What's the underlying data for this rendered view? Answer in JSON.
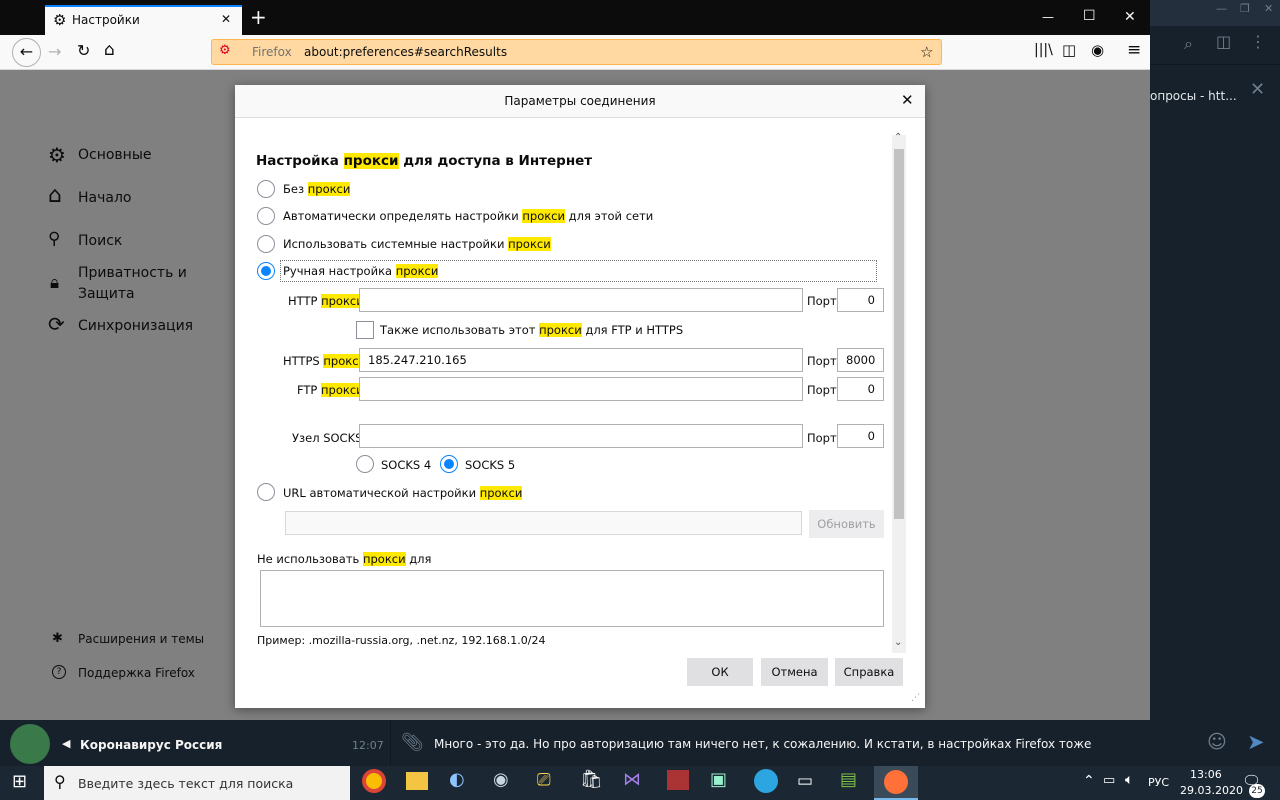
{
  "browser": {
    "tab_title": "Настройки",
    "new_tab": "+",
    "url_identity": "Firefox",
    "url": "about:preferences#searchResults",
    "win_min": "—",
    "win_max": "☐",
    "win_close": "✕"
  },
  "sidebar": {
    "items": [
      {
        "icon": "⚙",
        "label": "Основные"
      },
      {
        "icon": "⌂",
        "label": "Начало"
      },
      {
        "icon": "🔍",
        "label": "Поиск"
      },
      {
        "icon": "🔒",
        "label": "Приватность и Защита"
      },
      {
        "icon": "⟳",
        "label": "Синхронизация"
      }
    ],
    "footer": [
      {
        "icon": "✱",
        "label": "Расширения и темы"
      },
      {
        "icon": "?",
        "label": "Поддержка Firefox"
      }
    ]
  },
  "dialog": {
    "title": "Параметры соединения",
    "section": {
      "a": "Настройка ",
      "hl": "прокси",
      "b": " для доступа в Интернет"
    },
    "opts": {
      "none": {
        "a": "Без ",
        "hl": "прокси",
        "b": ""
      },
      "auto": {
        "a": "Автоматически определять настройки ",
        "hl": "прокси",
        "b": " для этой сети"
      },
      "system": {
        "a": "Использовать системные настройки ",
        "hl": "прокси",
        "b": ""
      },
      "manual": {
        "a": "Ручная настройка ",
        "hl": "прокси",
        "b": ""
      },
      "pac": {
        "a": "URL автоматической настройки ",
        "hl": "прокси",
        "b": ""
      }
    },
    "http": {
      "a": "HTTP ",
      "hl": "прокси",
      "value": "",
      "port_label": "Порт",
      "port": "0"
    },
    "also_use": {
      "a": "Также использовать этот ",
      "hl": "прокси",
      "b": " для FTP и HTTPS"
    },
    "https": {
      "a": "HTTPS ",
      "hl": "прокси",
      "value": "185.247.210.165",
      "port_label": "Порт",
      "port": "8000"
    },
    "ftp": {
      "a": "FTP ",
      "hl": "прокси",
      "value": "",
      "port_label": "Порт",
      "port": "0"
    },
    "socks": {
      "label": "Узел SOCKS",
      "value": "",
      "port_label": "Порт",
      "port": "0",
      "v4": "SOCKS 4",
      "v5": "SOCKS 5"
    },
    "pac_url": "",
    "reload": "Обновить",
    "no_proxy": {
      "a": "Не использовать ",
      "hl": "прокси",
      "b": " для"
    },
    "no_proxy_value": "",
    "example": "Пример: .mozilla-russia.org, .net.nz, 192.168.1.0/24",
    "ok": "ОК",
    "cancel": "Отмена",
    "help": "Справка"
  },
  "telegram": {
    "right_snippet": "опросы - htt...",
    "chat_name": "Коронавирус Россия",
    "chat_time": "12:07",
    "message": "Много - это да. Но про авторизацию там ничего нет, к сожалению. И кстати, в настройках Firefox тоже"
  },
  "taskbar": {
    "search_placeholder": "Введите здесь текст для поиска",
    "lang": "РУС",
    "time": "13:06",
    "date": "29.03.2020",
    "notif_count": "25"
  },
  "colors": {
    "accent": "#0a84ff",
    "highlight": "#ffe900",
    "url_bar": "#ffcc80",
    "telegram_bg": "#17212b"
  }
}
